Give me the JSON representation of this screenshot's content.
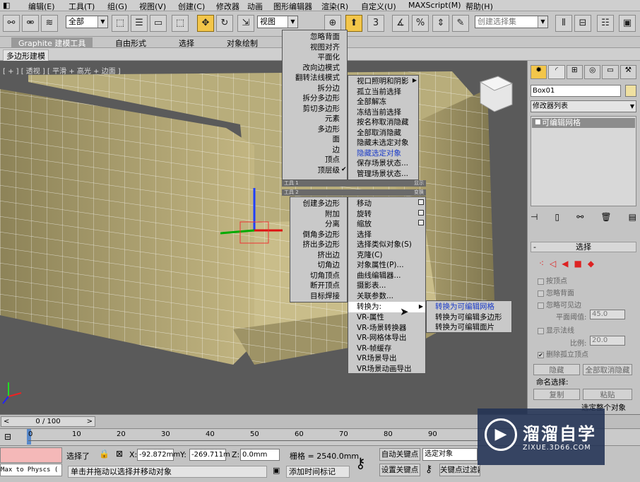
{
  "menubar": {
    "items": [
      "编辑(E)",
      "工具(T)",
      "组(G)",
      "视图(V)",
      "创建(C)",
      "修改器",
      "动画",
      "图形编辑器",
      "渲染(R)",
      "自定义(U)",
      "MAXScript(M)",
      "帮助(H)"
    ]
  },
  "toolbar": {
    "filter_select": "全部",
    "refcoord_select": "视图",
    "selset_select": "创建选择集",
    "snap_count": "3"
  },
  "ribbon": {
    "tabs": [
      "Graphite 建模工具",
      "自由形式",
      "选择",
      "对象绘制"
    ],
    "sub_tab": "多边形建模"
  },
  "viewport": {
    "label": "[ + ] [ 透视 ] [ 平滑 + 高光 + 边面 ]"
  },
  "quad_left_top": [
    "忽略背面",
    "视图对齐",
    "平面化",
    "改向边模式",
    "翻转法线模式",
    "拆分边",
    "拆分多边形",
    "剪切多边形",
    "元素",
    "多边形",
    "面",
    "边",
    "顶点",
    "顶层级"
  ],
  "quad_left_header": "工具 1",
  "quad_left_bottom_header": "工具 2",
  "quad_left_bottom": [
    "创建多边形",
    "附加",
    "分离",
    "倒角多边形",
    "挤出多边形",
    "挤出边",
    "切角边",
    "切角顶点",
    "断开顶点",
    "目标焊接"
  ],
  "quad_right_top": [
    "视口照明和阴影",
    "孤立当前选择",
    "全部解冻",
    "冻结当前选择",
    "按名称取消隐藏",
    "全部取消隐藏",
    "隐藏未选定对象",
    "隐藏选定对象",
    "保存场景状态...",
    "管理场景状态..."
  ],
  "quad_right_header": "显示",
  "quad_right_bottom_header": "变换",
  "quad_right_bottom": [
    "移动",
    "旋转",
    "缩放",
    "选择",
    "选择类似对象(S)",
    "克隆(C)",
    "对象属性(P)...",
    "曲线编辑器...",
    "摄影表...",
    "关联参数...",
    "转换为:",
    "VR-属性",
    "VR-场景转换器",
    "VR-网格体导出",
    "VR-帧缓存",
    "VR场景导出",
    "VR场景动画导出"
  ],
  "submenu": [
    "转换为可编辑网格",
    "转换为可编辑多边形",
    "转换为可编辑面片"
  ],
  "cmdpanel": {
    "object_name": "Box01",
    "modifier_list": "修改器列表",
    "stack_item": "可编辑网格",
    "rollout_title": "选择",
    "by_vertex": "按顶点",
    "ignore_backface": "忽略背面",
    "ignore_visible_edges": "忽略可见边",
    "planar_threshold_label": "平面阈值:",
    "planar_threshold": "45.0",
    "show_normals": "显示法线",
    "scale_label": "比例:",
    "scale": "20.0",
    "delete_isolated": "删除孤立顶点",
    "hide_btn": "隐藏",
    "unhide_all_btn": "全部取消隐藏",
    "named_sel_label": "命名选择:",
    "copy_btn": "复制",
    "paste_btn": "粘贴",
    "select_whole": "选定整个对象"
  },
  "timeline": {
    "frame": "0 / 100",
    "ticks": [
      "0",
      "10",
      "20",
      "30",
      "40",
      "50",
      "60",
      "70",
      "80",
      "90"
    ]
  },
  "status": {
    "script_label": "Max to Physcs (",
    "selected": "选择了",
    "x_label": "X:",
    "x": "-92.872mm",
    "y_label": "Y:",
    "y": "-269.711m",
    "z_label": "Z:",
    "z": "0.0mm",
    "grid": "栅格 = 2540.0mm",
    "autokey": "自动关键点",
    "selected_obj": "选定对象",
    "set_key": "设置关键点",
    "key_filter": "关键点过滤器...",
    "prompt": "单击并拖动以选择并移动对象",
    "add_time_tag": "添加时间标记"
  },
  "watermark": {
    "title": "溜溜自学",
    "url": "ZIXUE.3D66.COM"
  }
}
